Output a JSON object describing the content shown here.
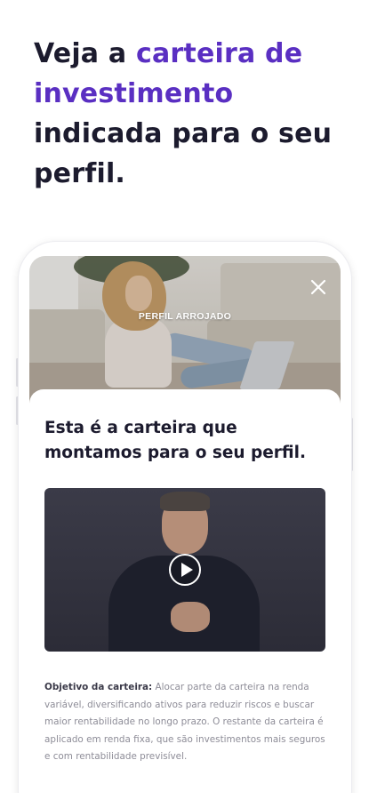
{
  "headline": {
    "part1": "Veja a ",
    "accent": "carteira de investimento",
    "part2": " indicada para o seu perfil."
  },
  "colors": {
    "accent": "#5a2fc2",
    "text_dark": "#1c1b2e",
    "text_muted": "#8d8c97"
  },
  "hero": {
    "label": "PERFIL ARROJADO",
    "close_icon": "close-icon"
  },
  "sheet": {
    "title": "Esta é a carteira que montamos para o seu perfil.",
    "video": {
      "play_icon": "play-icon"
    },
    "objective": {
      "label": "Objetivo da carteira:",
      "text": " Alocar parte da carteira na renda variável, diversificando ativos para reduzir riscos e buscar maior rentabilidade no longo prazo. O restante da carteira é aplicado em renda fixa, que são investimentos mais seguros e com rentabilidade previsível."
    }
  }
}
